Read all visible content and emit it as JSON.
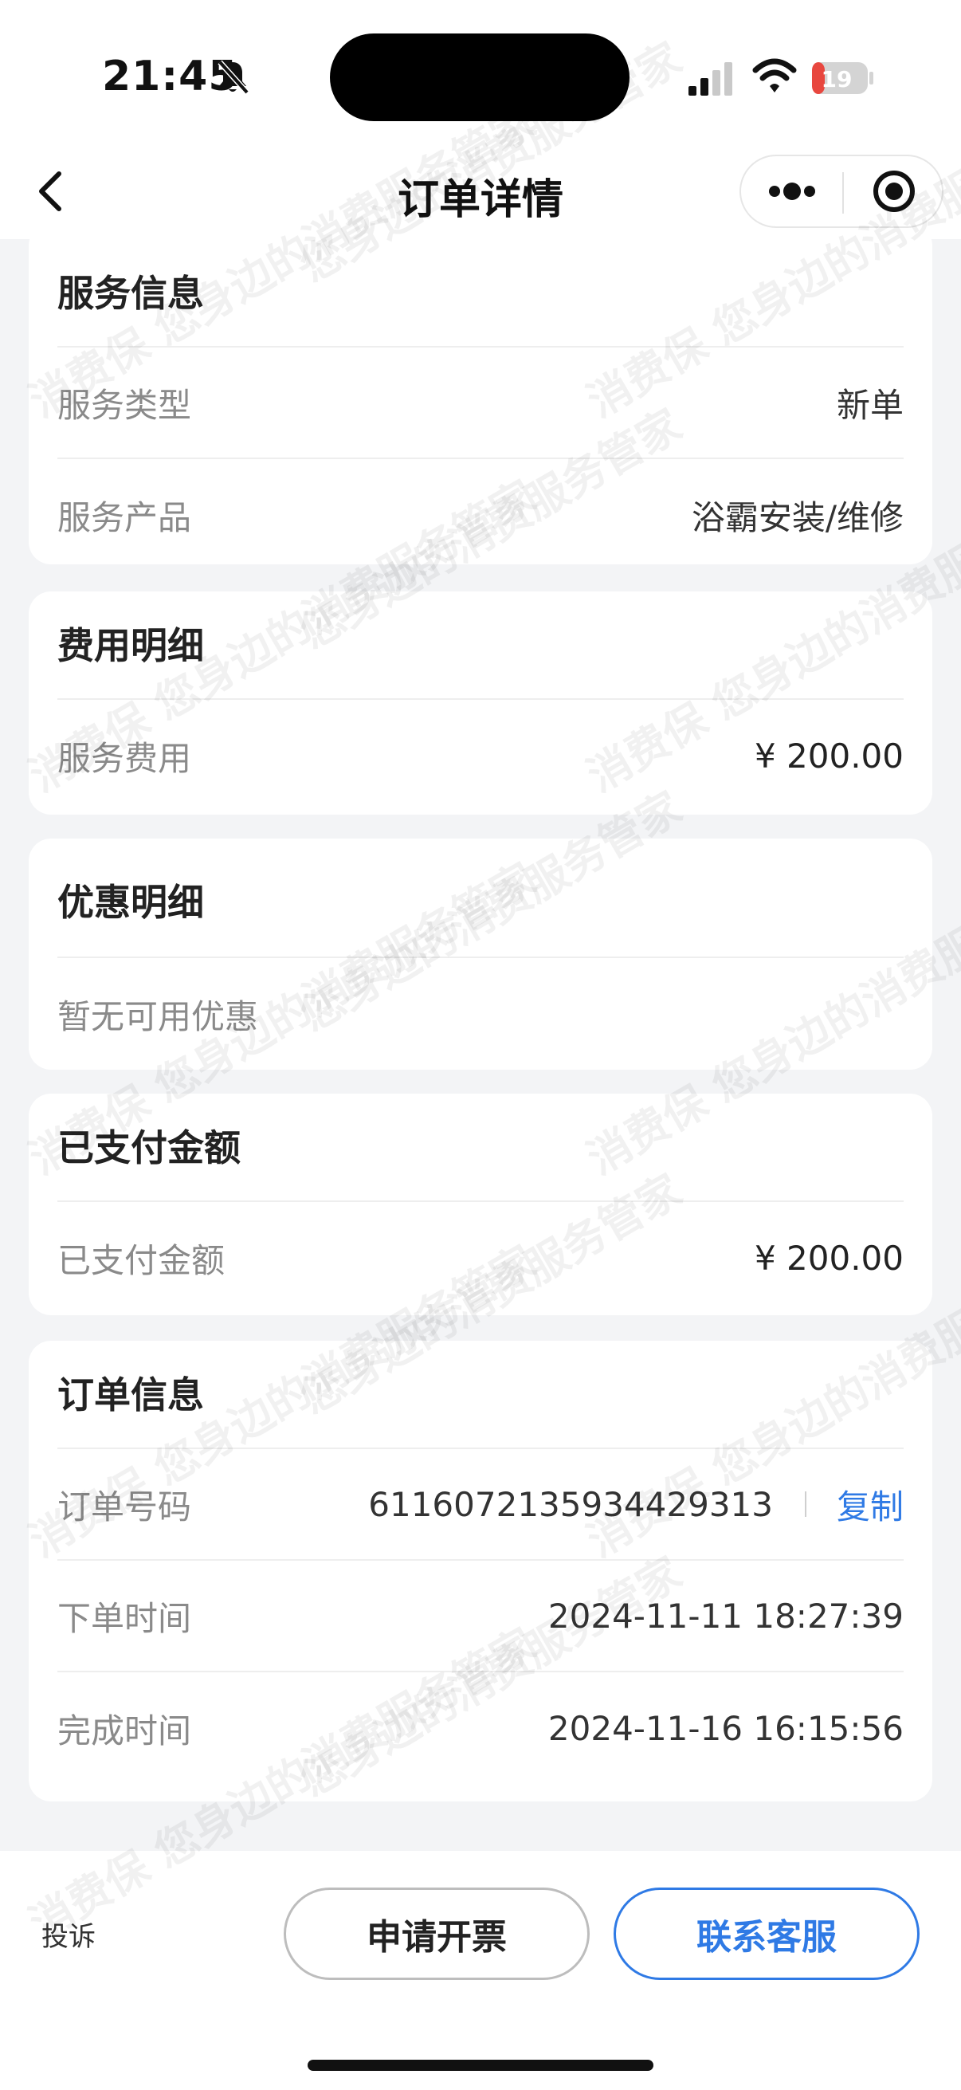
{
  "status_bar": {
    "time": "21:45",
    "battery": "19"
  },
  "nav": {
    "title": "订单详情"
  },
  "service_info": {
    "title": "服务信息",
    "rows": [
      {
        "label": "服务类型",
        "value": "新单"
      },
      {
        "label": "服务产品",
        "value": "浴霸安装/维修"
      }
    ]
  },
  "fee_detail": {
    "title": "费用明细",
    "rows": [
      {
        "label": "服务费用",
        "value": "¥ 200.00"
      }
    ]
  },
  "discount_detail": {
    "title": "优惠明细",
    "empty_text": "暂无可用优惠"
  },
  "paid": {
    "title": "已支付金额",
    "rows": [
      {
        "label": "已支付金额",
        "value": "¥ 200.00"
      }
    ]
  },
  "order_info": {
    "title": "订单信息",
    "order_no_label": "订单号码",
    "order_no": "6116072135934429313",
    "copy_label": "复制",
    "rows": [
      {
        "label": "下单时间",
        "value": "2024-11-11 18:27:39"
      },
      {
        "label": "完成时间",
        "value": "2024-11-16 16:15:56"
      }
    ]
  },
  "bottom": {
    "complain_label": "投诉",
    "invoice_label": "申请开票",
    "contact_label": "联系客服"
  },
  "watermark": {
    "text_a": "消费保 您身边的消费服务管家",
    "text_b": "您身边的消费服务管家"
  },
  "colors": {
    "accent": "#2f7ae5",
    "background": "#f3f4f6",
    "battery_low": "#e8473f"
  },
  "icons": [
    "bell-off-icon",
    "signal-icon",
    "wifi-icon",
    "battery-icon",
    "back-icon",
    "more-icon",
    "close-target-icon"
  ]
}
